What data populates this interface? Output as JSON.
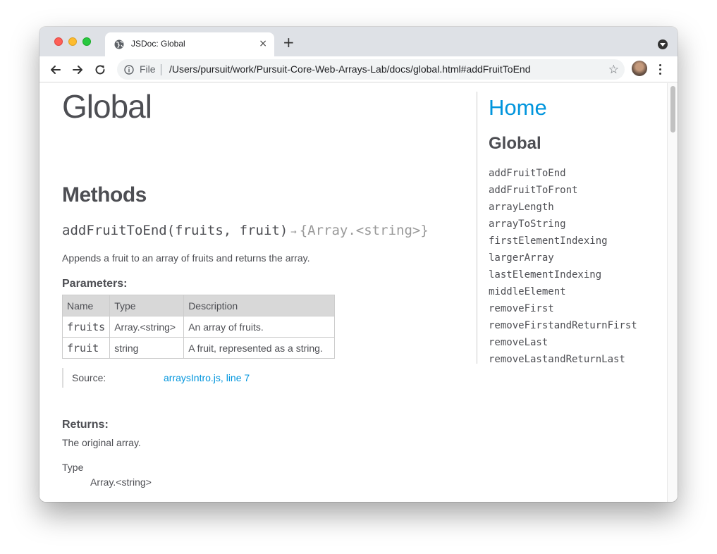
{
  "browser": {
    "tab_title": "JSDoc: Global",
    "tab_close": "×",
    "new_tab": "+",
    "file_label": "File",
    "url": "/Users/pursuit/work/Pursuit-Core-Web-Arrays-Lab/docs/global.html#addFruitToEnd",
    "icons": [
      "globe-icon",
      "back-arrow-icon",
      "forward-arrow-icon",
      "reload-icon",
      "info-icon",
      "star-icon",
      "avatar",
      "kebab-menu-icon"
    ]
  },
  "page": {
    "title": "Global",
    "methods_heading": "Methods",
    "method": {
      "name": "addFruitToEnd(fruits, fruit)",
      "arrow": "→",
      "returns_type": "{Array.<string>}",
      "description": "Appends a fruit to an array of fruits and returns the array."
    },
    "parameters": {
      "heading": "Parameters:",
      "columns": [
        "Name",
        "Type",
        "Description"
      ],
      "rows": [
        [
          "fruits",
          "Array.<string>",
          "An array of fruits."
        ],
        [
          "fruit",
          "string",
          "A fruit, represented as a string."
        ]
      ]
    },
    "source": {
      "label": "Source:",
      "file": "arraysIntro.js",
      "separator": ", ",
      "line": "line 7"
    },
    "returns": {
      "heading": "Returns:",
      "description": "The original array.",
      "type_label": "Type",
      "type_value": "Array.<string>"
    }
  },
  "nav": {
    "home": "Home",
    "section": "Global",
    "items": [
      "addFruitToEnd",
      "addFruitToFront",
      "arrayLength",
      "arrayToString",
      "firstElementIndexing",
      "largerArray",
      "lastElementIndexing",
      "middleElement",
      "removeFirst",
      "removeFirstandReturnFirst",
      "removeLast",
      "removeLastandReturnLast"
    ]
  },
  "colors": {
    "link": "#0095dd",
    "text": "#4d4e53",
    "tabbar": "#dee1e6"
  }
}
